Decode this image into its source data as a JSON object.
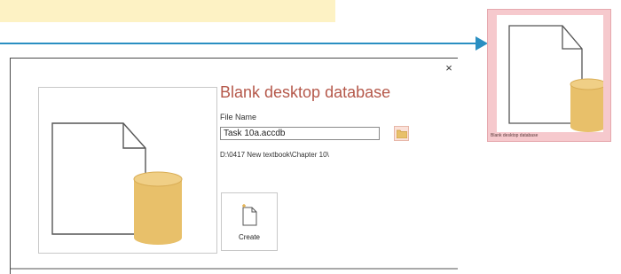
{
  "dialog": {
    "title": "Blank desktop database",
    "close_label": "×",
    "file_name_label": "File Name",
    "file_name_value": "Task 10a.accdb",
    "path": "D:\\0417 New textbook\\Chapter 10\\",
    "create_label": "Create"
  },
  "template_tile": {
    "label": "Blank desktop database"
  },
  "colors": {
    "accent_title": "#b5584a",
    "database_gold": "#e8c06a",
    "arrow_blue": "#2a8fc2",
    "tile_pink": "#f6c9cd",
    "callout_yellow": "#fdf2c4"
  },
  "icons": [
    "database-icon",
    "folder-icon",
    "new-file-icon",
    "close-icon",
    "arrow-icon"
  ]
}
